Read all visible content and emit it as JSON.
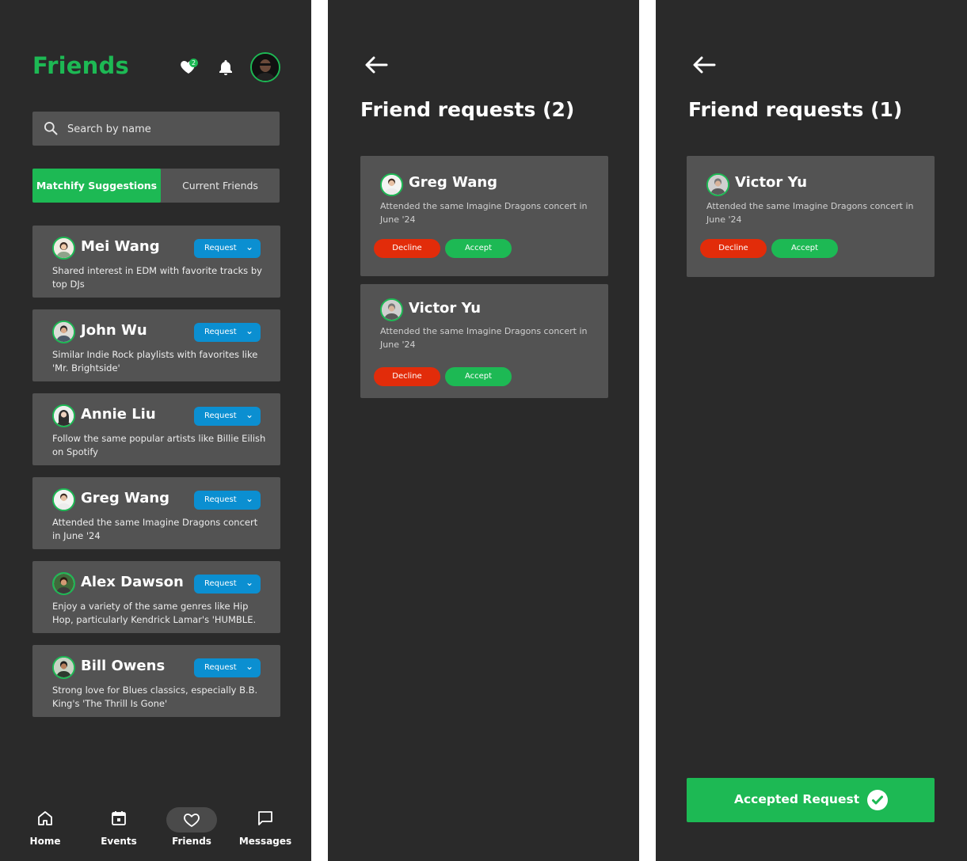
{
  "screen1": {
    "title": "Friends",
    "likes_badge": "2",
    "search": {
      "placeholder": "Search by name"
    },
    "tabs": {
      "active": "Matchify Suggestions",
      "inactive": "Current Friends"
    },
    "request_label": "Request",
    "suggestions": [
      {
        "name": "Mei Wang",
        "desc": "Shared interest in EDM with favorite tracks by top DJs"
      },
      {
        "name": "John Wu",
        "desc": "Similar Indie Rock playlists with favorites like 'Mr. Brightside'"
      },
      {
        "name": "Annie Liu",
        "desc": "Follow the same popular artists like Billie Eilish on Spotify"
      },
      {
        "name": "Greg Wang",
        "desc": "Attended the same Imagine Dragons concert in June '24"
      },
      {
        "name": "Alex Dawson",
        "desc": "Enjoy a variety of the same genres like Hip Hop, particularly Kendrick Lamar's 'HUMBLE."
      },
      {
        "name": "Bill Owens",
        "desc": "Strong love for Blues classics, especially B.B. King's 'The Thrill Is Gone'"
      }
    ],
    "nav": [
      {
        "label": "Home",
        "icon": "home-icon"
      },
      {
        "label": "Events",
        "icon": "calendar-icon"
      },
      {
        "label": "Friends",
        "icon": "heart-icon"
      },
      {
        "label": "Messages",
        "icon": "chat-icon"
      }
    ]
  },
  "screen2": {
    "title": "Friend requests (2)",
    "requests": [
      {
        "name": "Greg Wang",
        "desc": "Attended the same Imagine Dragons concert in June '24"
      },
      {
        "name": "Victor Yu",
        "desc": "Attended the same Imagine Dragons concert in June '24"
      }
    ],
    "decline_label": "Decline",
    "accept_label": "Accept"
  },
  "screen3": {
    "title": "Friend requests (1)",
    "requests": [
      {
        "name": "Victor Yu",
        "desc": "Attended the same Imagine Dragons concert in June '24"
      }
    ],
    "decline_label": "Decline",
    "accept_label": "Accept",
    "toast": "Accepted Request"
  },
  "colors": {
    "accent": "#1db954",
    "request": "#0b8fd1",
    "decline": "#e22c0a",
    "background": "#2a2a2a",
    "card": "#535353"
  }
}
